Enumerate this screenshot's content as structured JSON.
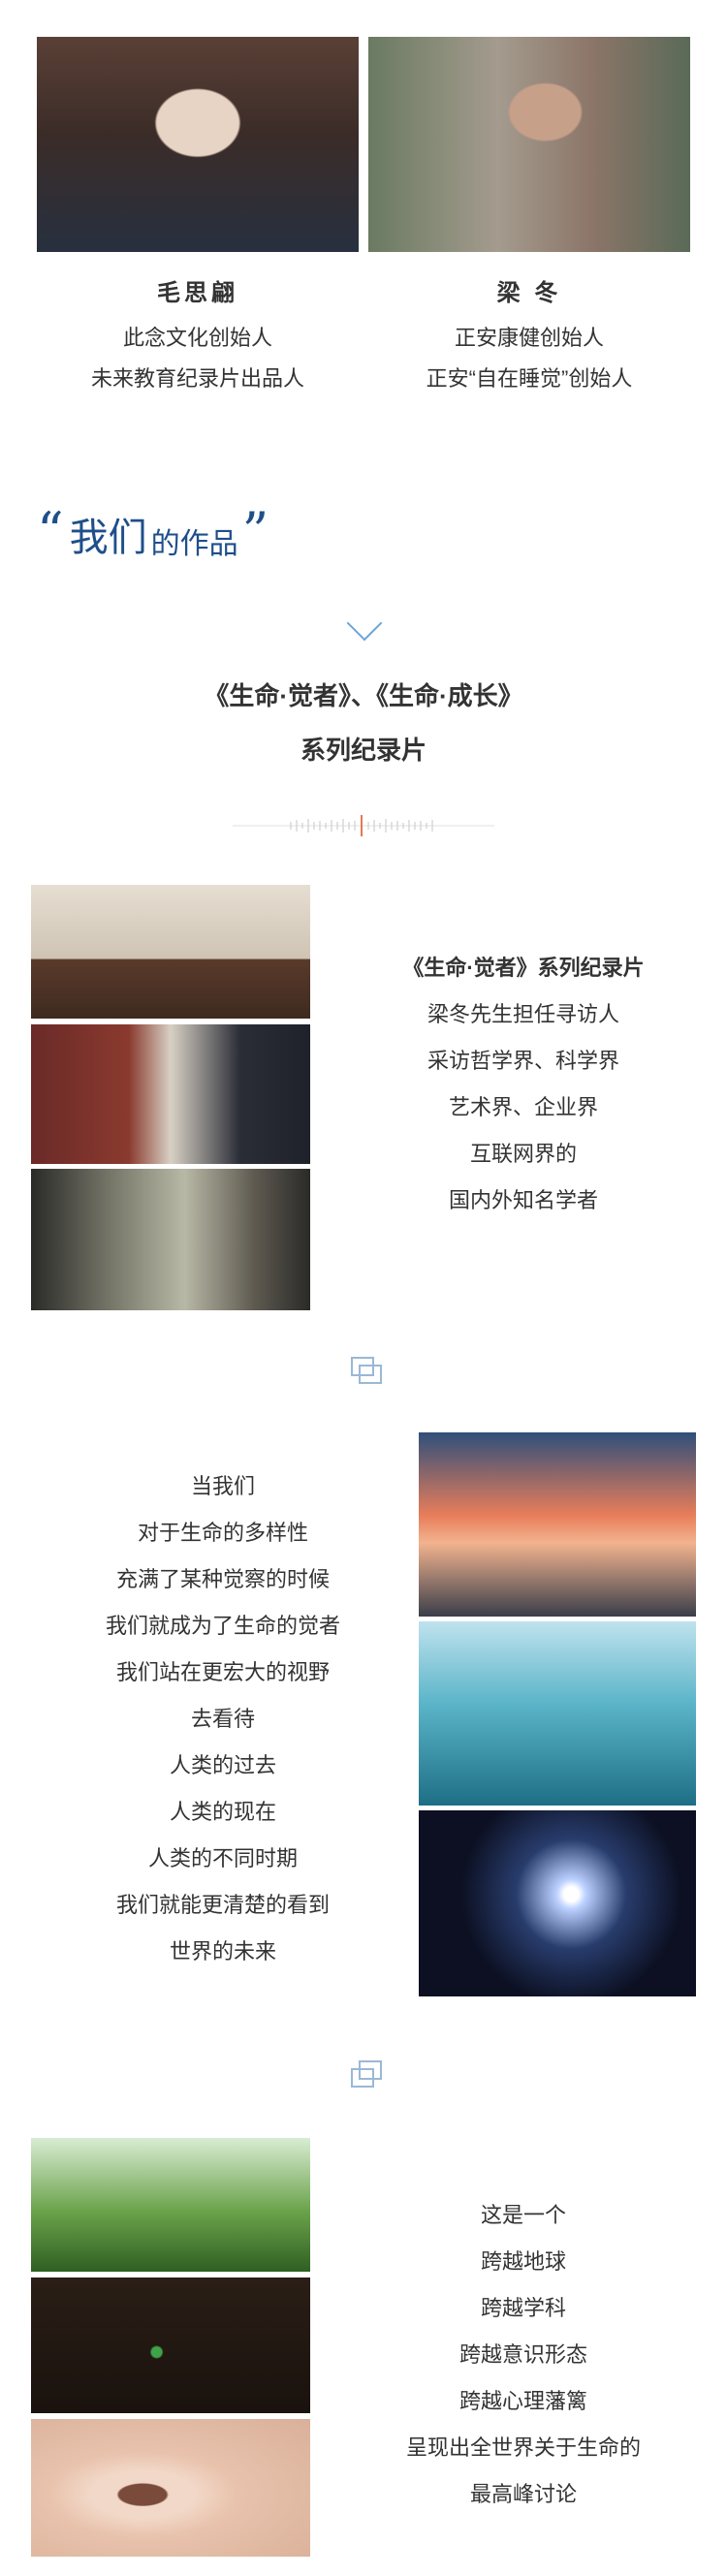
{
  "people": [
    {
      "name": "毛思翩",
      "lines": [
        "此念文化创始人",
        "未来教育纪录片出品人"
      ]
    },
    {
      "name": "梁  冬",
      "lines": [
        "正安康健创始人",
        "正安“自在睡觉”创始人"
      ]
    }
  ],
  "section": {
    "open_quote": "“",
    "title_big": "我们",
    "title_small": "的作品",
    "close_quote": "”"
  },
  "series": {
    "line1": "《生命·觉者》、《生命·成长》",
    "line2": "系列纪录片"
  },
  "block1": [
    "《生命·觉者》系列纪录片",
    "梁冬先生担任寻访人",
    "采访哲学界、科学界",
    "艺术界、企业界",
    "互联网界的",
    "国内外知名学者"
  ],
  "block2": [
    "当我们",
    "对于生命的多样性",
    "充满了某种觉察的时候",
    "我们就成为了生命的觉者",
    "我们站在更宏大的视野",
    "去看待",
    "人类的过去",
    "人类的现在",
    "人类的不同时期",
    "我们就能更清楚的看到",
    "世界的未来"
  ],
  "block3": [
    "这是一个",
    "跨越地球",
    "跨越学科",
    "跨越意识形态",
    "跨越心理藩篱",
    "呈现出全世界关于生命的",
    "最高峰讨论"
  ],
  "colors": {
    "accent": "#1e4f8a",
    "icon": "#9ab8d6",
    "divider_mark": "#e07b52"
  }
}
